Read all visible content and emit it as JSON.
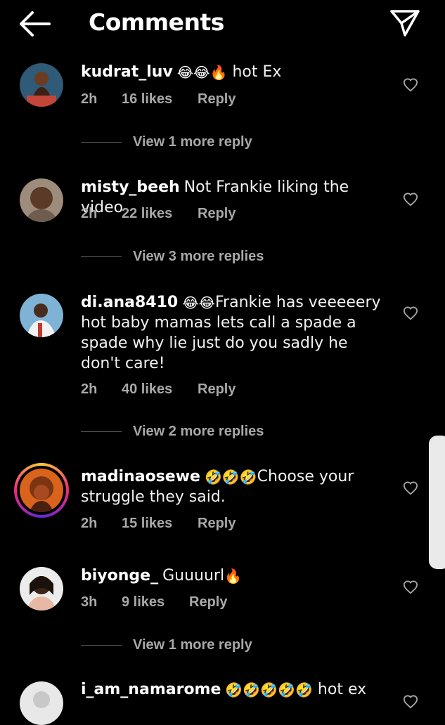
{
  "header": {
    "title": "Comments"
  },
  "comments": [
    {
      "user": "kudrat_luv",
      "emoji": "😂😂🔥",
      "text": "hot Ex",
      "time": "2h",
      "likes": "16 likes",
      "reply": "Reply",
      "view_more": "View 1 more reply"
    },
    {
      "user": "misty_beeh",
      "emoji": "",
      "text": "Not Frankie liking the video",
      "time": "2h",
      "likes": "22 likes",
      "reply": "Reply",
      "view_more": "View 3 more replies"
    },
    {
      "user": "di.ana8410",
      "emoji": "😂😂",
      "text": "Frankie has veeeeery hot baby mamas lets call a spade a spade why lie just do you sadly he don't care!",
      "time": "2h",
      "likes": "40 likes",
      "reply": "Reply",
      "view_more": "View 2 more replies"
    },
    {
      "user": "madinaosewe",
      "emoji": "🤣🤣🤣",
      "text": "Choose your struggle they said.",
      "time": "2h",
      "likes": "15 likes",
      "reply": "Reply",
      "view_more": ""
    },
    {
      "user": "biyonge_",
      "emoji": "",
      "text": "Guuuurl",
      "emoji_after": "🔥",
      "time": "3h",
      "likes": "9 likes",
      "reply": "Reply",
      "view_more": "View 1 more reply"
    },
    {
      "user": "i_am_namarome",
      "emoji": "🤣🤣🤣🤣🤣",
      "text": "hot ex"
    }
  ],
  "colors": {
    "background": "#000000",
    "meta_text": "#a8a8a8",
    "story_ring_start": "#f9ce34",
    "story_ring_mid": "#ee2a7b"
  },
  "icons": [
    "back-arrow-icon",
    "send-icon",
    "heart-icon"
  ]
}
